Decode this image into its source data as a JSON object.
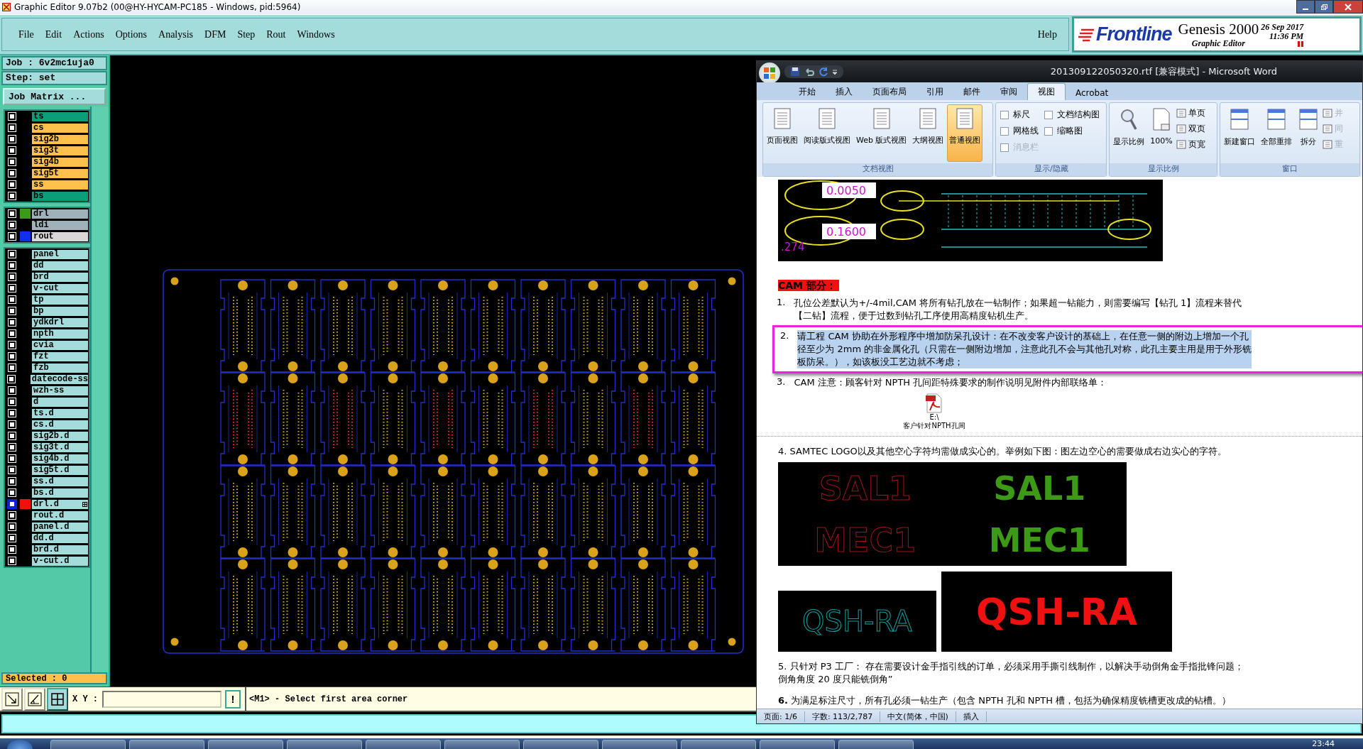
{
  "window": {
    "title": "Graphic Editor 9.07b2 (00@HY-HYCAM-PC185 - Windows, pid:5964)"
  },
  "menu": [
    "File",
    "Edit",
    "Actions",
    "Options",
    "Analysis",
    "DFM",
    "Step",
    "Rout",
    "Windows"
  ],
  "help": "Help",
  "brand": {
    "logo": "Frontline",
    "product": "Genesis 2000",
    "module": "Graphic Editor",
    "date": "26 Sep 2017",
    "time": "11:36 PM"
  },
  "job": {
    "job": "Job : 6v2mc1uja0",
    "step": "Step: set",
    "matrix_button": "Job Matrix ..."
  },
  "layer_groups": [
    {
      "layers": [
        {
          "name": "ts",
          "kind": "mask",
          "selected": false
        },
        {
          "name": "cs",
          "kind": "signal",
          "selected": false
        },
        {
          "name": "sig2b",
          "kind": "signal",
          "selected": false
        },
        {
          "name": "sig3t",
          "kind": "signal",
          "selected": false
        },
        {
          "name": "sig4b",
          "kind": "signal",
          "selected": false
        },
        {
          "name": "sig5t",
          "kind": "signal",
          "selected": false
        },
        {
          "name": "ss",
          "kind": "signal",
          "selected": false
        },
        {
          "name": "bs",
          "kind": "mask",
          "selected": false
        }
      ]
    },
    {
      "layers": [
        {
          "name": "drl",
          "kind": "drill",
          "color": "#3c9a1a",
          "selected": false
        },
        {
          "name": "ldi",
          "kind": "drill",
          "selected": false
        },
        {
          "name": "rout",
          "kind": "rout",
          "color": "#1030f0",
          "selected": false
        }
      ]
    },
    {
      "layers": [
        {
          "name": "panel",
          "kind": "misc",
          "selected": false
        },
        {
          "name": "dd",
          "kind": "misc",
          "selected": false
        },
        {
          "name": "brd",
          "kind": "misc",
          "selected": false
        },
        {
          "name": "v-cut",
          "kind": "misc",
          "selected": false
        },
        {
          "name": "tp",
          "kind": "misc",
          "selected": false
        },
        {
          "name": "bp",
          "kind": "misc",
          "selected": false
        },
        {
          "name": "ydkdrl",
          "kind": "misc",
          "selected": false
        },
        {
          "name": "npth",
          "kind": "misc",
          "selected": false
        },
        {
          "name": "cvia",
          "kind": "misc",
          "selected": false
        },
        {
          "name": "fzt",
          "kind": "misc",
          "selected": false
        },
        {
          "name": "fzb",
          "kind": "misc",
          "selected": false
        },
        {
          "name": "datecode-ss",
          "kind": "misc",
          "selected": false
        },
        {
          "name": "wzh-ss",
          "kind": "misc",
          "selected": false
        },
        {
          "name": "d",
          "kind": "misc",
          "selected": false
        },
        {
          "name": "ts.d",
          "kind": "misc",
          "selected": false
        },
        {
          "name": "cs.d",
          "kind": "misc",
          "selected": false
        },
        {
          "name": "sig2b.d",
          "kind": "misc",
          "selected": false
        },
        {
          "name": "sig3t.d",
          "kind": "misc",
          "selected": false
        },
        {
          "name": "sig4b.d",
          "kind": "misc",
          "selected": false
        },
        {
          "name": "sig5t.d",
          "kind": "misc",
          "selected": false
        },
        {
          "name": "ss.d",
          "kind": "misc",
          "selected": false
        },
        {
          "name": "bs.d",
          "kind": "misc",
          "selected": false
        },
        {
          "name": "drl.d",
          "kind": "misc",
          "color": "#f01010",
          "selected": true
        },
        {
          "name": "rout.d",
          "kind": "misc",
          "selected": false
        },
        {
          "name": "panel.d",
          "kind": "misc",
          "selected": false
        },
        {
          "name": "dd.d",
          "kind": "misc",
          "selected": false
        },
        {
          "name": "brd.d",
          "kind": "misc",
          "selected": false
        },
        {
          "name": "v-cut.d",
          "kind": "misc",
          "selected": false
        }
      ]
    }
  ],
  "selected_count": "Selected : 0",
  "command_bar": {
    "xy_label": "X Y :",
    "confirm": "!",
    "prompt": "<M1> - Select first area corner"
  },
  "word": {
    "title": "201309122050320.rtf [兼容模式] - Microsoft Word",
    "tabs": [
      {
        "label": "开始",
        "selected": false
      },
      {
        "label": "插入",
        "selected": false
      },
      {
        "label": "页面布局",
        "selected": false
      },
      {
        "label": "引用",
        "selected": false
      },
      {
        "label": "邮件",
        "selected": false
      },
      {
        "label": "审阅",
        "selected": false
      },
      {
        "label": "视图",
        "selected": true
      },
      {
        "label": "Acrobat",
        "selected": false
      }
    ],
    "groups": [
      {
        "kind": "views",
        "title": "文档视图",
        "buttons": [
          {
            "label": "页面视图",
            "selected": false
          },
          {
            "label": "阅读版式视图",
            "selected": false
          },
          {
            "label": "Web 版式视图",
            "selected": false
          },
          {
            "label": "大纲视图",
            "selected": false
          },
          {
            "label": "普通视图",
            "selected": true
          }
        ]
      },
      {
        "kind": "checks",
        "title": "显示/隐藏",
        "items": [
          {
            "label": "标尺",
            "checked": false,
            "disabled": false
          },
          {
            "label": "文档结构图",
            "checked": false,
            "disabled": false
          },
          {
            "label": "网格线",
            "checked": false,
            "disabled": false
          },
          {
            "label": "缩略图",
            "checked": false,
            "disabled": false
          },
          {
            "label": "消息栏",
            "checked": false,
            "disabled": true
          }
        ]
      },
      {
        "kind": "zoom",
        "title": "显示比例",
        "buttons": [
          {
            "label": "显示比例"
          },
          {
            "label": "100%"
          }
        ],
        "small": [
          {
            "label": "单页",
            "disabled": false
          },
          {
            "label": "双页",
            "disabled": false
          },
          {
            "label": "页宽",
            "disabled": false
          }
        ]
      },
      {
        "kind": "window",
        "title": "窗口",
        "buttons": [
          {
            "label": "新建窗口"
          },
          {
            "label": "全部重排"
          },
          {
            "label": "拆分"
          }
        ],
        "small": [
          {
            "label": "并",
            "disabled": true
          },
          {
            "label": "同",
            "disabled": true
          },
          {
            "label": "重",
            "disabled": true
          }
        ]
      }
    ],
    "blocks": [
      {
        "kind": "figure",
        "labels": [
          "0.0050",
          "0.1600",
          ".274"
        ]
      },
      {
        "kind": "heading",
        "text": "CAM 部分："
      },
      {
        "kind": "item",
        "number": "1.",
        "lines": [
          "孔位公差默认为+/-4mil,CAM 将所有钻孔放在一钻制作；如果超一钻能力，则需要编写【钻孔 1】流程来替代",
          "【二钻】流程，便于过数到钻孔工序使用高精度钻机生产。"
        ],
        "selected": false,
        "annotated": false
      },
      {
        "kind": "item",
        "number": "2.",
        "lines": [
          "请工程 CAM 协助在外形程序中增加防呆孔设计：在不改变客户设计的基础上，在任意一侧的附边上增加一个孔",
          "径至少为 2mm 的非金属化孔（只需在一侧附边增加，注意此孔不会与其他孔对称，此孔主要主用是用于外形铣",
          "板防呆。），如该板没工艺边就不考虑；"
        ],
        "selected": true,
        "annotated": true
      },
      {
        "kind": "item",
        "number": "3.",
        "lines": [
          "CAM 注意：顾客针对 NPTH 孔间距特殊要求的制作说明见附件内部联络单："
        ],
        "selected": false,
        "annotated": false
      },
      {
        "kind": "attachment",
        "path": "E:\\",
        "name": "客户针对NPTH孔间"
      },
      {
        "kind": "para",
        "lines": [
          "4. SAMTEC LOGO以及其他空心字符均需做成实心的。举例如下图：图左边空心的需要做成右边实心的字符。"
        ]
      },
      {
        "kind": "logos",
        "outline": [
          "SAL1",
          "MEC1"
        ],
        "solid": [
          "SAL1",
          "MEC1"
        ]
      },
      {
        "kind": "logo_pair",
        "outline": "QSH-RA",
        "solid": "QSH-RA"
      },
      {
        "kind": "para",
        "lines": [
          "5. 只针对 P3 工厂：    存在需要设计金手指引线的订单，必须采用手撕引线制作，以解决手动倒角金手指批锋问题；",
          "倒角角度 20 度只能铣倒角”"
        ]
      },
      {
        "kind": "para",
        "lines": [
          "**6.**  为满足标注尺寸，所有孔必须一钻生产（包含 NPTH 孔和 NPTH 槽，包括为确保精度铣槽更改成的钻槽。）"
        ]
      }
    ],
    "status": [
      "页面: 1/6",
      "字数: 113/2,787",
      "中文(简体，中国)",
      "插入"
    ]
  },
  "taskbar": {
    "clock": "23:44"
  }
}
